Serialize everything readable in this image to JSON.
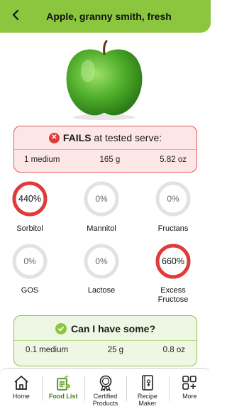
{
  "header": {
    "title": "Apple, granny smith, fresh",
    "back_icon": "chevron-left-icon"
  },
  "result": {
    "status": "FAILS",
    "status_suffix": " at tested serve:",
    "serve_quantity": "1 medium",
    "serve_grams": "165 g",
    "serve_ounces": "5.82 oz"
  },
  "gauges": [
    {
      "label": "Sorbitol",
      "value": "440%",
      "level": 4.4,
      "status": "high"
    },
    {
      "label": "Mannitol",
      "value": "0%",
      "level": 0,
      "status": "low"
    },
    {
      "label": "Fructans",
      "value": "0%",
      "level": 0,
      "status": "low"
    },
    {
      "label": "GOS",
      "value": "0%",
      "level": 0,
      "status": "low"
    },
    {
      "label": "Lactose",
      "value": "0%",
      "level": 0,
      "status": "low"
    },
    {
      "label": "Excess Fructose",
      "value": "660%",
      "level": 6.6,
      "status": "high"
    }
  ],
  "safe": {
    "title": "Can I have some?",
    "serve_quantity": "0.1 medium",
    "serve_grams": "25 g",
    "serve_ounces": "0.8 oz"
  },
  "nav": {
    "items": [
      {
        "label": "Home",
        "icon": "home-icon",
        "active": false
      },
      {
        "label": "Food List",
        "icon": "food-list-icon",
        "active": true
      },
      {
        "label": "Certified Products",
        "icon": "certified-badge-icon",
        "active": false
      },
      {
        "label": "Recipe Maker",
        "icon": "recipe-book-icon",
        "active": false
      },
      {
        "label": "More",
        "icon": "more-grid-icon",
        "active": false
      }
    ]
  },
  "colors": {
    "brand_green": "#8cc63f",
    "fail_red": "#e03a3a",
    "gauge_track": "#e2e2e2"
  }
}
